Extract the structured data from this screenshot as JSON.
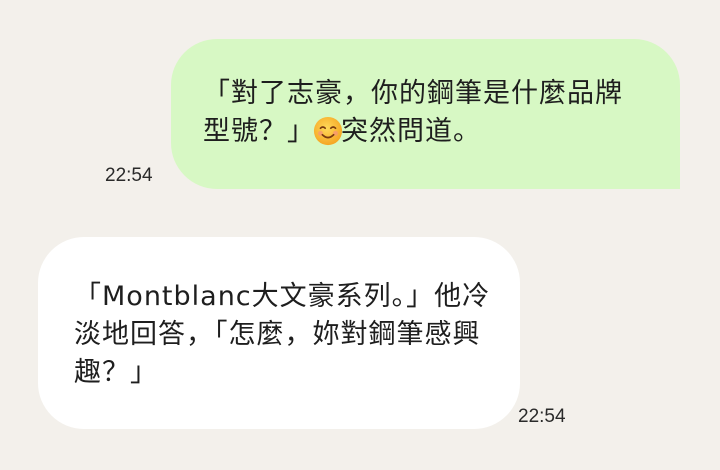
{
  "messages": [
    {
      "direction": "outgoing",
      "text_before_emoji": "「對了志豪，你的鋼筆是什麼品牌型號？」",
      "emoji": "smiling-face-icon",
      "text_after_emoji": "突然問道。",
      "time": "22:54",
      "bubble_color": "#d7f8c4"
    },
    {
      "direction": "incoming",
      "text": "「Montblanc大文豪系列。」他冷淡地回答，「怎麼，妳對鋼筆感興趣？」",
      "time": "22:54",
      "bubble_color": "#ffffff"
    }
  ],
  "background_color": "#f3f0eb"
}
